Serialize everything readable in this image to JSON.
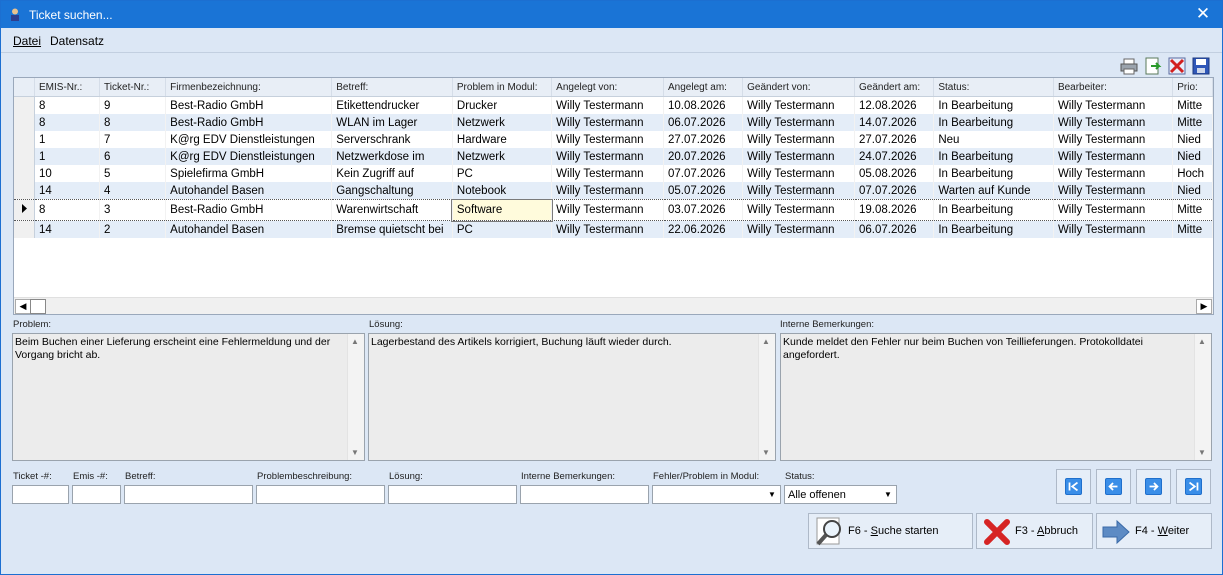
{
  "window": {
    "title": "Ticket suchen...",
    "close_glyph": "✕"
  },
  "menu": [
    {
      "label": "Datei"
    },
    {
      "label": "Datensatz"
    }
  ],
  "toolbar_icons": [
    "printer-icon",
    "export-icon",
    "delete-icon",
    "save-icon"
  ],
  "grid": {
    "columns": [
      "EMIS-Nr.:",
      "Ticket-Nr.:",
      "Firmenbezeichnung:",
      "Betreff:",
      "Problem in Modul:",
      "Angelegt von:",
      "Angelegt am:",
      "Geändert von:",
      "Geändert am:",
      "Status:",
      "Bearbeiter:",
      "Prio:"
    ],
    "rows": [
      [
        "8",
        "9",
        "Best-Radio GmbH",
        "Etikettendrucker",
        "Drucker",
        "Willy Testermann",
        "10.08.2026",
        "Willy Testermann",
        "12.08.2026",
        "In Bearbeitung",
        "Willy Testermann",
        "Mitte"
      ],
      [
        "8",
        "8",
        "Best-Radio GmbH",
        "WLAN im Lager",
        "Netzwerk",
        "Willy Testermann",
        "06.07.2026",
        "Willy Testermann",
        "14.07.2026",
        "In Bearbeitung",
        "Willy Testermann",
        "Mitte"
      ],
      [
        "1",
        "7",
        "K@rg EDV Dienstleistungen",
        "Serverschrank",
        "Hardware",
        "Willy Testermann",
        "27.07.2026",
        "Willy Testermann",
        "27.07.2026",
        "Neu",
        "Willy Testermann",
        "Nied"
      ],
      [
        "1",
        "6",
        "K@rg EDV Dienstleistungen",
        "Netzwerkdose im",
        "Netzwerk",
        "Willy Testermann",
        "20.07.2026",
        "Willy Testermann",
        "24.07.2026",
        "In Bearbeitung",
        "Willy Testermann",
        "Nied"
      ],
      [
        "10",
        "5",
        "Spielefirma GmbH",
        "Kein Zugriff auf",
        "PC",
        "Willy Testermann",
        "07.07.2026",
        "Willy Testermann",
        "05.08.2026",
        "In Bearbeitung",
        "Willy Testermann",
        "Hoch"
      ],
      [
        "14",
        "4",
        "Autohandel Basen",
        "Gangschaltung",
        "Notebook",
        "Willy Testermann",
        "05.07.2026",
        "Willy Testermann",
        "07.07.2026",
        "Warten auf Kunde",
        "Willy Testermann",
        "Nied"
      ],
      [
        "8",
        "3",
        "Best-Radio GmbH",
        "Warenwirtschaft",
        "Software",
        "Willy Testermann",
        "03.07.2026",
        "Willy Testermann",
        "19.08.2026",
        "In Bearbeitung",
        "Willy Testermann",
        "Mitte"
      ],
      [
        "14",
        "2",
        "Autohandel Basen",
        "Bremse quietscht bei",
        "PC",
        "Willy Testermann",
        "22.06.2026",
        "Willy Testermann",
        "06.07.2026",
        "In Bearbeitung",
        "Willy Testermann",
        "Mitte"
      ]
    ],
    "selected_row_index": 6,
    "editing_column_index": 4
  },
  "details": {
    "problem_label": "Problem:",
    "problem_text": "Beim Buchen einer Lieferung erscheint eine Fehlermeldung und der Vorgang bricht ab.",
    "loesung_label": "Lösung:",
    "loesung_text": "Lagerbestand des Artikels korrigiert, Buchung läuft wieder durch.",
    "interne_label": "Interne Bemerkungen:",
    "interne_text": "Kunde meldet den Fehler nur beim Buchen von Teillieferungen. Protokolldatei angefordert."
  },
  "search": {
    "ticket_label": "Ticket -#:",
    "ticket_value": "",
    "emis_label": "Emis -#:",
    "emis_value": "",
    "betreff_label": "Betreff:",
    "betreff_value": "",
    "problembeschreibung_label": "Problembeschreibung:",
    "problembeschreibung_value": "",
    "loesung_label": "Lösung:",
    "loesung_value": "",
    "interne_label": "Interne Bemerkungen:",
    "interne_value": "",
    "modul_label": "Fehler/Problem in Modul:",
    "modul_value": "",
    "status_label": "Status:",
    "status_value": "Alle offenen"
  },
  "nav_icons": [
    "first-record-icon",
    "previous-record-icon",
    "next-record-icon",
    "last-record-icon"
  ],
  "buttons": {
    "search": {
      "prefix": "F6 - ",
      "key": "S",
      "rest": "uche starten"
    },
    "cancel": {
      "prefix": "F3 - ",
      "key": "A",
      "rest": "bbruch"
    },
    "next": {
      "prefix": "F4 - ",
      "key": "W",
      "rest": "eiter"
    }
  },
  "colors": {
    "titlebar": "#1a74d6",
    "window_bg": "#dce7f5",
    "row_alt": "#e4edf8",
    "edit_cell": "#fffbdc"
  }
}
